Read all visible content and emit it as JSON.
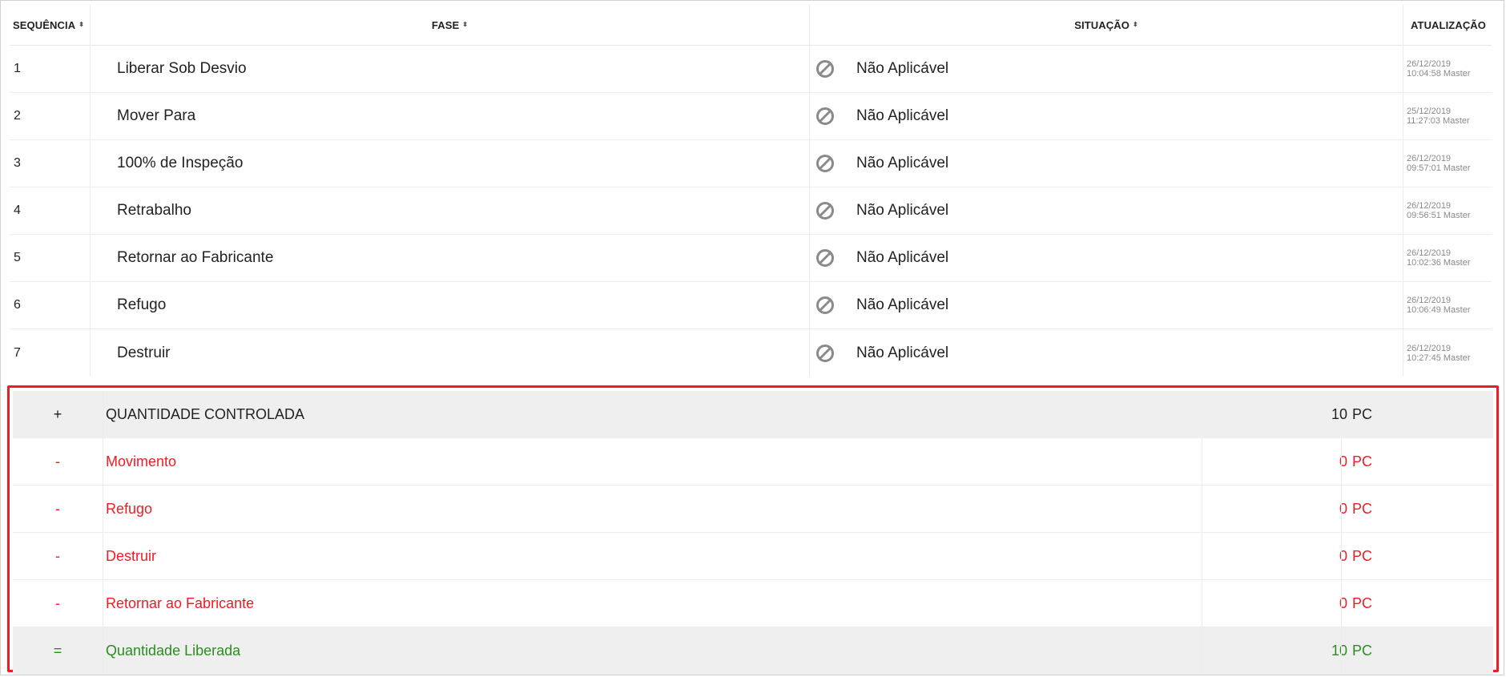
{
  "table": {
    "headers": {
      "seq": "SEQUÊNCIA",
      "fase": "FASE",
      "situacao": "SITUAÇÃO",
      "atualizacao": "ATUALIZAÇÃO"
    },
    "sort_glyph": "⬍",
    "status_icon": "not-applicable-icon",
    "rows": [
      {
        "seq": "1",
        "fase": "Liberar Sob Desvio",
        "situacao": "Não Aplicável",
        "date": "26/12/2019",
        "time_user": "10:04:58 Master"
      },
      {
        "seq": "2",
        "fase": "Mover Para",
        "situacao": "Não Aplicável",
        "date": "25/12/2019",
        "time_user": "11:27:03 Master"
      },
      {
        "seq": "3",
        "fase": "100% de Inspeção",
        "situacao": "Não Aplicável",
        "date": "26/12/2019",
        "time_user": "09:57:01 Master"
      },
      {
        "seq": "4",
        "fase": "Retrabalho",
        "situacao": "Não Aplicável",
        "date": "26/12/2019",
        "time_user": "09:56:51 Master"
      },
      {
        "seq": "5",
        "fase": "Retornar ao Fabricante",
        "situacao": "Não Aplicável",
        "date": "26/12/2019",
        "time_user": "10:02:36 Master"
      },
      {
        "seq": "6",
        "fase": "Refugo",
        "situacao": "Não Aplicável",
        "date": "26/12/2019",
        "time_user": "10:06:49 Master"
      },
      {
        "seq": "7",
        "fase": "Destruir",
        "situacao": "Não Aplicável",
        "date": "26/12/2019",
        "time_user": "10:27:45 Master"
      }
    ]
  },
  "summary": {
    "highlight_color": "#ee1c25",
    "rows": [
      {
        "sign": "+",
        "label": "QUANTIDADE CONTROLADA",
        "value": "10",
        "unit": "PC",
        "tone": "black"
      },
      {
        "sign": "-",
        "label": "Movimento",
        "value": "0",
        "unit": "PC",
        "tone": "red"
      },
      {
        "sign": "-",
        "label": "Refugo",
        "value": "0",
        "unit": "PC",
        "tone": "red"
      },
      {
        "sign": "-",
        "label": "Destruir",
        "value": "0",
        "unit": "PC",
        "tone": "red"
      },
      {
        "sign": "-",
        "label": "Retornar ao Fabricante",
        "value": "0",
        "unit": "PC",
        "tone": "red"
      },
      {
        "sign": "=",
        "label": "Quantidade Liberada",
        "value": "10",
        "unit": "PC",
        "tone": "green"
      }
    ]
  }
}
